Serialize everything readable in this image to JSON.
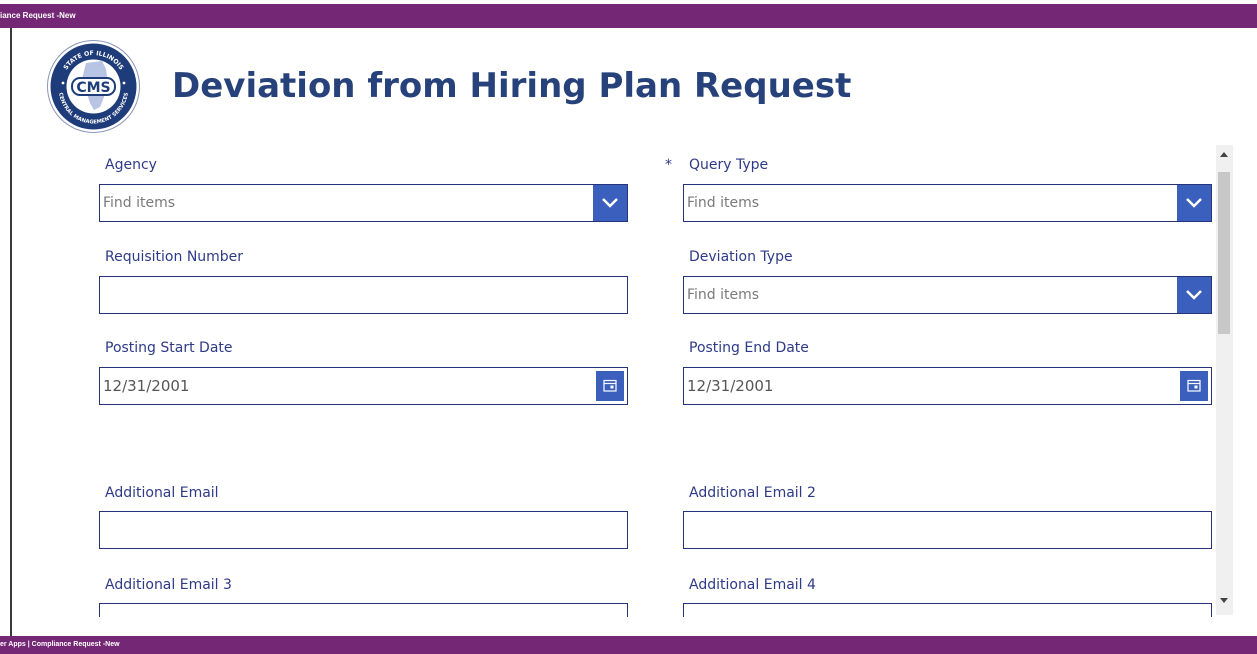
{
  "window": {
    "title_top": "iance Request -New",
    "title_bottom": "er Apps | Compliance Request -New"
  },
  "header": {
    "logo_icon": "cms-seal-icon",
    "logo_ring_top": "STATE OF ILLINOIS",
    "logo_ring_bottom": "CENTRAL MANAGEMENT SERVICES",
    "logo_center": "CMS",
    "title": "Deviation from Hiring Plan Request"
  },
  "form": {
    "agency": {
      "label": "Agency",
      "placeholder": "Find items"
    },
    "query_type": {
      "required_marker": "*",
      "label": "Query Type",
      "placeholder": "Find items"
    },
    "requisition_number": {
      "label": "Requisition Number",
      "value": ""
    },
    "deviation_type": {
      "label": "Deviation Type",
      "placeholder": "Find items"
    },
    "posting_start_date": {
      "label": "Posting Start Date",
      "value": "12/31/2001"
    },
    "posting_end_date": {
      "label": "Posting End Date",
      "value": "12/31/2001"
    },
    "additional_email": {
      "label": "Additional Email",
      "value": ""
    },
    "additional_email_2": {
      "label": "Additional Email 2",
      "value": ""
    },
    "additional_email_3": {
      "label": "Additional Email 3"
    },
    "additional_email_4": {
      "label": "Additional Email 4"
    }
  },
  "colors": {
    "titlebar": "#742774",
    "accent": "#3b5fbd",
    "label": "#2e3a87",
    "heading": "#27427a"
  }
}
